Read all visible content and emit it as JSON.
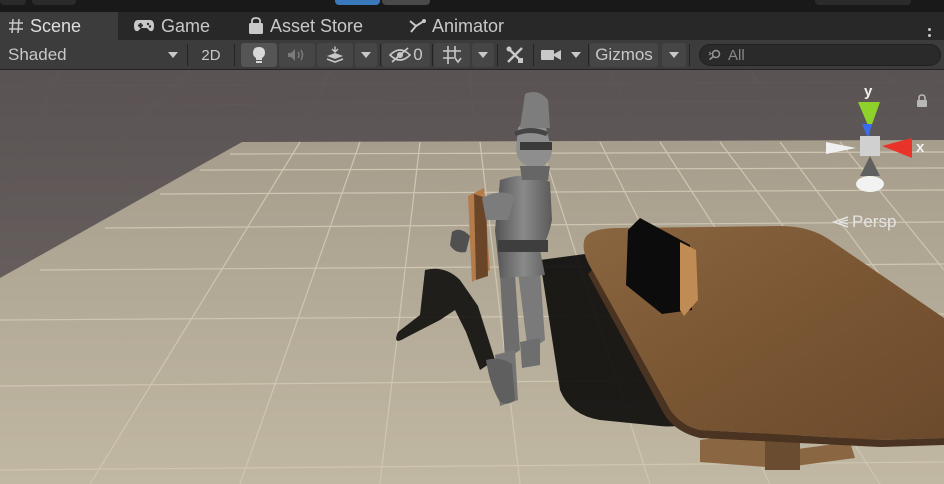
{
  "tabs": [
    {
      "label": "Scene",
      "icon": "hash-icon",
      "active": true
    },
    {
      "label": "Game",
      "icon": "gamepad-icon",
      "active": false
    },
    {
      "label": "Asset Store",
      "icon": "shopping-bag-icon",
      "active": false
    },
    {
      "label": "Animator",
      "icon": "animator-icon",
      "active": false
    }
  ],
  "toolbar": {
    "shading_mode": "Shaded",
    "toggle_2d": "2D",
    "hidden_count": "0",
    "gizmos_label": "Gizmos",
    "search_placeholder": "All"
  },
  "viewport": {
    "axis_y": "y",
    "axis_x": "x",
    "projection": "Persp"
  },
  "colors": {
    "accent": "#3a79bb",
    "axis_x": "#e8322a",
    "axis_y": "#8ed12a",
    "axis_z": "#3a6cf0",
    "floor": "#b7ad98",
    "void": "#4c4848"
  }
}
